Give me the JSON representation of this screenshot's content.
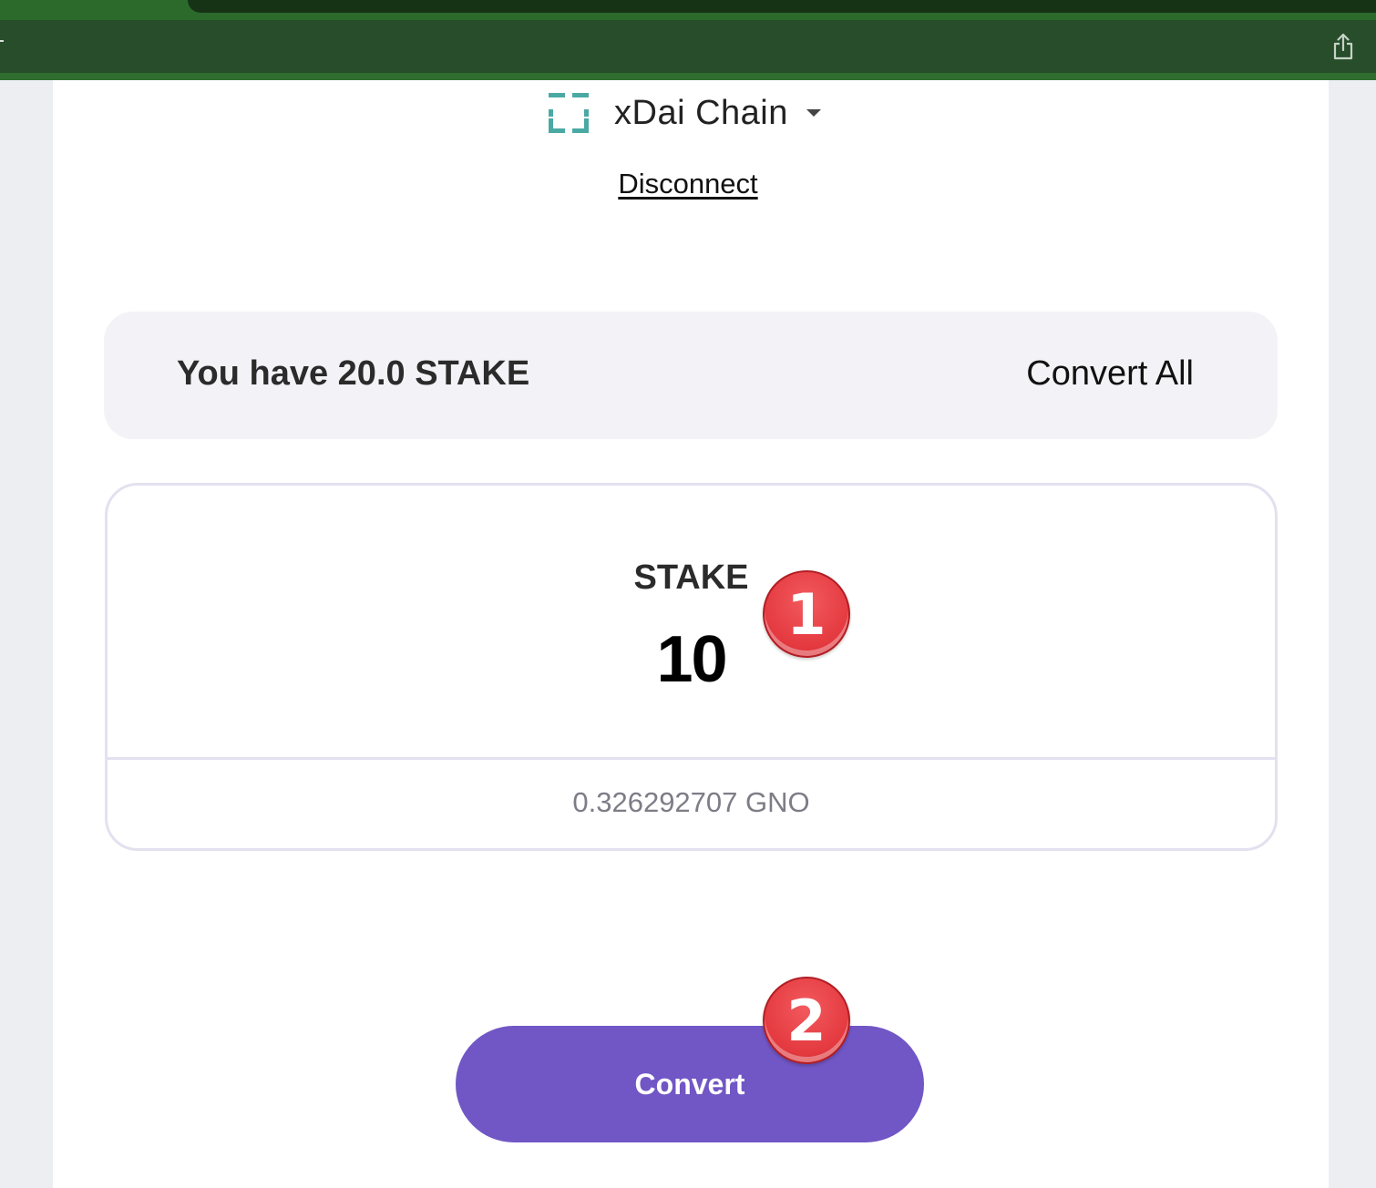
{
  "browser": {
    "share_icon": "share-icon"
  },
  "network": {
    "name": "xDai Chain",
    "icon": "xdai-chain-icon",
    "caret_icon": "caret-down-icon",
    "icon_color": "#4ba9a4"
  },
  "account": {
    "disconnect_label": "Disconnect"
  },
  "balance": {
    "text": "You have 20.0 STAKE",
    "convert_all_label": "Convert All"
  },
  "converter": {
    "input_token": "STAKE",
    "input_amount": "10",
    "output_value": "0.326292707 GNO"
  },
  "actions": {
    "convert_label": "Convert",
    "primary_color": "#7156c5"
  },
  "annotations": {
    "step_1": "1",
    "step_2": "2",
    "badge_color": "#e43a40"
  }
}
